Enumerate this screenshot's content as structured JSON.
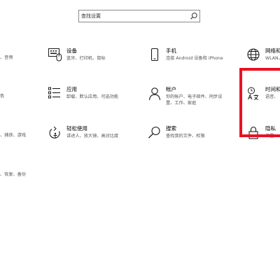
{
  "search": {
    "placeholder": "查找设置"
  },
  "left_fragments": [
    "、音频",
    "色",
    "、捕获、游戏",
    "、恢复、备份"
  ],
  "tiles": {
    "devices": {
      "title": "设备",
      "desc": "蓝牙、打印机、鼠标"
    },
    "phone": {
      "title": "手机",
      "desc": "连接 Android 设备和 iPhone"
    },
    "network": {
      "title": "网络和",
      "desc": "WLAN、"
    },
    "apps": {
      "title": "应用",
      "desc": "卸载、默认应用、可选功能"
    },
    "accounts": {
      "title": "帐户",
      "desc": "你的帐户、电子邮件、同步设\n置、工作、家庭"
    },
    "time": {
      "title": "时间和",
      "desc": "语音、"
    },
    "ease": {
      "title": "轻松使用",
      "desc": "讲述人、放大镜、高对比度"
    },
    "search_tile": {
      "title": "搜索",
      "desc": "查找我的文件、权限"
    },
    "privacy": {
      "title": "隐私",
      "desc": "位置、"
    }
  },
  "icons": {
    "search": "search-icon",
    "devices": "keyboard-device-icon",
    "phone": "phone-icon",
    "network": "globe-icon",
    "apps": "apps-list-icon",
    "accounts": "person-icon",
    "time": "clock-language-icon",
    "ease": "ease-of-access-icon",
    "search_tile": "magnifier-icon",
    "privacy": "lock-icon"
  },
  "colors": {
    "highlight": "#e81123",
    "icon": "#1a1a1a",
    "desc": "#555555"
  }
}
